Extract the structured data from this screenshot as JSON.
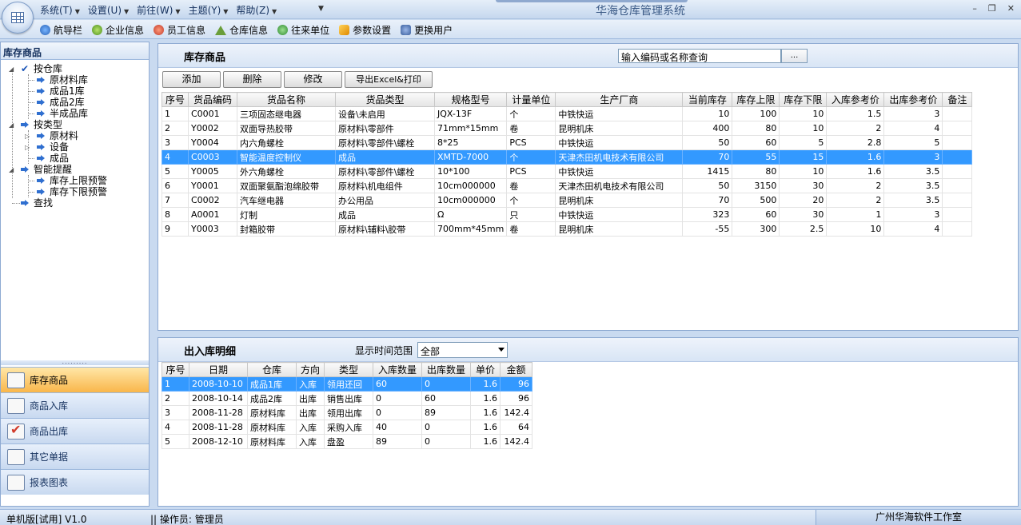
{
  "app": {
    "title": "华海仓库管理系统",
    "menus": [
      "系统(T)",
      "设置(U)",
      "前往(W)",
      "主题(Y)",
      "帮助(Z)"
    ]
  },
  "toolbar": {
    "items": [
      {
        "label": "航导栏",
        "icon": "navigation-icon"
      },
      {
        "label": "企业信息",
        "icon": "enterprise-icon"
      },
      {
        "label": "员工信息",
        "icon": "employee-icon"
      },
      {
        "label": "仓库信息",
        "icon": "warehouse-icon"
      },
      {
        "label": "往来单位",
        "icon": "partner-icon"
      },
      {
        "label": "参数设置",
        "icon": "settings-icon"
      },
      {
        "label": "更换用户",
        "icon": "switch-user-icon"
      }
    ]
  },
  "sidebar": {
    "title": "库存商品",
    "tree": {
      "by_warehouse": "按仓库",
      "warehouses": [
        "原材料库",
        "成品1库",
        "成品2库",
        "半成品库"
      ],
      "by_type": "按类型",
      "types": [
        "原材料",
        "设备",
        "成品"
      ],
      "alerts": "智能提醒",
      "alert_items": [
        "库存上限预警",
        "库存下限预警"
      ],
      "search": "查找"
    },
    "nav": [
      "库存商品",
      "商品入库",
      "商品出库",
      "其它单据",
      "报表图表"
    ],
    "active_nav": "库存商品"
  },
  "stock": {
    "title": "库存商品",
    "search_value": "输入编码或名称查询",
    "search_button": "...",
    "buttons": [
      "添加",
      "删除",
      "修改",
      "导出Excel&打印"
    ],
    "columns": [
      "序号",
      "货品编码",
      "货品名称",
      "货品类型",
      "规格型号",
      "计量单位",
      "生产厂商",
      "当前库存",
      "库存上限",
      "库存下限",
      "入库参考价",
      "出库参考价",
      "备注"
    ],
    "rows": [
      [
        "1",
        "C0001",
        "三项固态继电器",
        "设备\\未启用",
        "JQX-13F",
        "个",
        "中铁快运",
        "10",
        "100",
        "10",
        "1.5",
        "3",
        ""
      ],
      [
        "2",
        "Y0002",
        "双面导热胶带",
        "原材料\\零部件",
        "71mm*15mm",
        "卷",
        "昆明机床",
        "400",
        "80",
        "10",
        "2",
        "4",
        ""
      ],
      [
        "3",
        "Y0004",
        "内六角螺栓",
        "原材料\\零部件\\螺栓",
        "8*25",
        "PCS",
        "中铁快运",
        "50",
        "60",
        "5",
        "2.8",
        "5",
        ""
      ],
      [
        "4",
        "C0003",
        "智能温度控制仪",
        "成品",
        "XMTD-7000",
        "个",
        "天津杰田机电技术有限公司",
        "70",
        "55",
        "15",
        "1.6",
        "3",
        ""
      ],
      [
        "5",
        "Y0005",
        "外六角螺栓",
        "原材料\\零部件\\螺栓",
        "10*100",
        "PCS",
        "中铁快运",
        "1415",
        "80",
        "10",
        "1.6",
        "3.5",
        ""
      ],
      [
        "6",
        "Y0001",
        "双面聚氨酯泡绵胶带",
        "原材料\\机电组件",
        "10cm000000",
        "卷",
        "天津杰田机电技术有限公司",
        "50",
        "3150",
        "30",
        "2",
        "3.5",
        ""
      ],
      [
        "7",
        "C0002",
        "汽车继电器",
        "办公用品",
        "10cm000000",
        "个",
        "昆明机床",
        "70",
        "500",
        "20",
        "2",
        "3.5",
        ""
      ],
      [
        "8",
        "A0001",
        "灯制",
        "成品",
        "Ω",
        "只",
        "中铁快运",
        "323",
        "60",
        "30",
        "1",
        "3",
        ""
      ],
      [
        "9",
        "Y0003",
        "封箱胶带",
        "原材料\\辅料\\胶带",
        "700mm*45mm",
        "卷",
        "昆明机床",
        "-55",
        "300",
        "2.5",
        "10",
        "4",
        ""
      ]
    ],
    "selected_row": 3
  },
  "flow": {
    "title": "出入库明细",
    "filter_label": "显示时间范围",
    "filter_value": "全部",
    "columns": [
      "序号",
      "日期",
      "仓库",
      "方向",
      "类型",
      "入库数量",
      "出库数量",
      "单价",
      "金额"
    ],
    "rows": [
      [
        "1",
        "2008-10-10",
        "成品1库",
        "入库",
        "领用还回",
        "60",
        "0",
        "1.6",
        "96"
      ],
      [
        "2",
        "2008-10-14",
        "成品2库",
        "出库",
        "销售出库",
        "0",
        "60",
        "1.6",
        "96"
      ],
      [
        "3",
        "2008-11-28",
        "原材料库",
        "出库",
        "领用出库",
        "0",
        "89",
        "1.6",
        "142.4"
      ],
      [
        "4",
        "2008-11-28",
        "原材料库",
        "入库",
        "采购入库",
        "40",
        "0",
        "1.6",
        "64"
      ],
      [
        "5",
        "2008-12-10",
        "原材料库",
        "入库",
        "盘盈",
        "89",
        "0",
        "1.6",
        "142.4"
      ]
    ],
    "selected_row": 0
  },
  "status": {
    "version": "单机版[试用] V1.0",
    "operator": "|| 操作员: 管理员",
    "company": "广州华海软件工作室"
  }
}
